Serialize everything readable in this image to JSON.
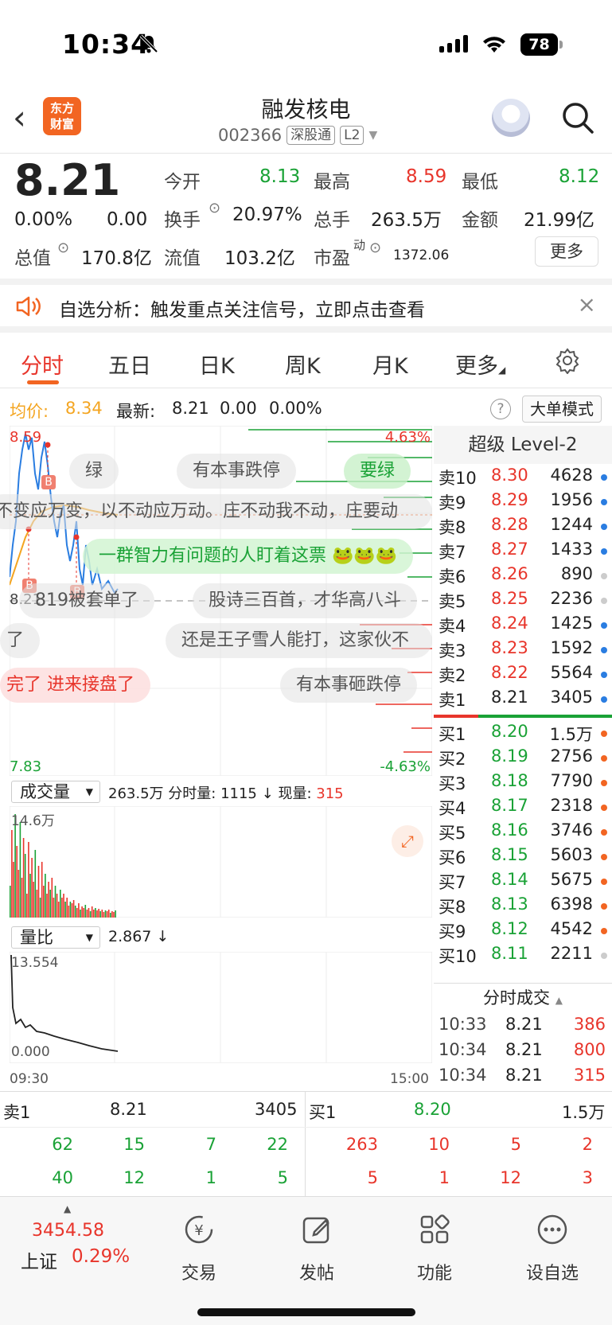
{
  "status_bar": {
    "time": "10:34",
    "battery": "78"
  },
  "header": {
    "logo_line1": "东方",
    "logo_line2": "财富",
    "stock_name": "融发核电",
    "code": "002366",
    "tag1": "深股通",
    "tag2": "L2"
  },
  "quote": {
    "price": "8.21",
    "change_pct": "0.00%",
    "change": "0.00",
    "open_label": "今开",
    "open": "8.13",
    "high_label": "最高",
    "high": "8.59",
    "low_label": "最低",
    "low": "8.12",
    "turnover_label": "换手",
    "turnover": "20.97%",
    "volume_label": "总手",
    "volume": "263.5万",
    "amount_label": "金额",
    "amount": "21.99亿",
    "mktcap_label": "总值",
    "mktcap": "170.8亿",
    "float_label": "流值",
    "float": "103.2亿",
    "pe_label": "市盈",
    "pe_sup": "动",
    "pe": "1372.06",
    "more": "更多"
  },
  "banner": {
    "text": "自选分析：触发重点关注信号，立即点击查看",
    "close": "×"
  },
  "tabs": [
    "分时",
    "五日",
    "日K",
    "周K",
    "月K",
    "更多"
  ],
  "info": {
    "avg_label": "均价:",
    "avg": "8.34",
    "last_label": "最新:",
    "last": "8.21",
    "chg": "0.00",
    "pct": "0.00%",
    "mode": "大单模式"
  },
  "chart": {
    "high_price": "8.59",
    "high_pct": "4.63%",
    "ref_price": "8.21",
    "low_price": "7.83",
    "low_pct": "-4.63%",
    "time_start": "09:30",
    "time_end": "15:00",
    "marker": "B"
  },
  "danmaku": [
    "绿",
    "有本事跌停",
    "要绿",
    "以不变应万变，以不动应万动。庄不动我不动，庄要动",
    "一群智力有问题的人盯着这票",
    "819被套单了",
    "股诗三百首，才华高八斗",
    "了",
    "还是王子雪人能打，这家伙不",
    "完了 进来接盘了",
    "有本事砸跌停"
  ],
  "volume": {
    "label": "成交量",
    "total": "263.5万",
    "period_label": "分时量:",
    "period": "1115",
    "now_label": "现量:",
    "now": "315",
    "max": "14.6万"
  },
  "ratio": {
    "label": "量比",
    "value": "2.867",
    "max": "13.554",
    "min": "0.000"
  },
  "level2": {
    "title": "超级 Level-2",
    "asks": [
      [
        "卖10",
        "8.30",
        "4628"
      ],
      [
        "卖9",
        "8.29",
        "1956"
      ],
      [
        "卖8",
        "8.28",
        "1244"
      ],
      [
        "卖7",
        "8.27",
        "1433"
      ],
      [
        "卖6",
        "8.26",
        "890"
      ],
      [
        "卖5",
        "8.25",
        "2236"
      ],
      [
        "卖4",
        "8.24",
        "1425"
      ],
      [
        "卖3",
        "8.23",
        "1592"
      ],
      [
        "卖2",
        "8.22",
        "5564"
      ],
      [
        "卖1",
        "8.21",
        "3405"
      ]
    ],
    "bids": [
      [
        "买1",
        "8.20",
        "1.5万"
      ],
      [
        "买2",
        "8.19",
        "2756"
      ],
      [
        "买3",
        "8.18",
        "7790"
      ],
      [
        "买4",
        "8.17",
        "2318"
      ],
      [
        "买5",
        "8.16",
        "3746"
      ],
      [
        "买6",
        "8.15",
        "5603"
      ],
      [
        "买7",
        "8.14",
        "5675"
      ],
      [
        "买8",
        "8.13",
        "6398"
      ],
      [
        "买9",
        "8.12",
        "4542"
      ],
      [
        "买10",
        "8.11",
        "2211"
      ]
    ]
  },
  "ticks": {
    "title": "分时成交",
    "rows": [
      [
        "10:33",
        "8.21",
        "386"
      ],
      [
        "10:34",
        "8.21",
        "800"
      ],
      [
        "10:34",
        "8.21",
        "315"
      ]
    ]
  },
  "bottom": {
    "ask_label": "卖1",
    "ask_price": "8.21",
    "ask_vol": "3405",
    "bid_label": "买1",
    "bid_price": "8.20",
    "bid_vol": "1.5万",
    "left_r1": [
      "62",
      "15",
      "7",
      "22"
    ],
    "left_r2": [
      "40",
      "12",
      "1",
      "5"
    ],
    "right_r1": [
      "263",
      "10",
      "5",
      "2"
    ],
    "right_r2": [
      "5",
      "1",
      "12",
      "3"
    ]
  },
  "nav": {
    "index_value": "3454.58",
    "index_name": "上证",
    "index_pct": "0.29%",
    "items": [
      "交易",
      "发帖",
      "功能",
      "设自选"
    ]
  },
  "colors": {
    "red": "#e8352b",
    "green": "#1aa236",
    "brand": "#f26522"
  }
}
